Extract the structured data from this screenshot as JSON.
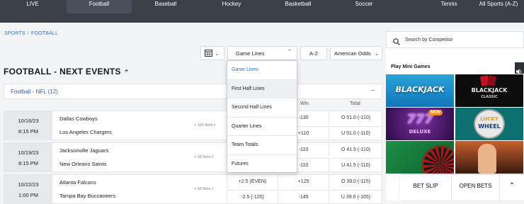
{
  "nav": {
    "items": [
      "LIVE",
      "Football",
      "Baseball",
      "Hockey",
      "Basketball",
      "Soccer",
      "Tennis",
      "All Sports (A-Z)"
    ],
    "active": "Football"
  },
  "breadcrumb": {
    "sports": "SPORTS",
    "sep": "/",
    "football": "FOOTBALL"
  },
  "controls": {
    "market": "Game Lines",
    "sort": "A-Z",
    "odds_format": "American Odds"
  },
  "section_title": "FOOTBALL - NEXT EVENTS",
  "league": {
    "label": "Football - NFL (12)",
    "collapse": "–"
  },
  "columns": {
    "win": "Win",
    "total": "Total"
  },
  "events": [
    {
      "date": "10/16/23",
      "time": "8:15 PM",
      "home": "Dallas Cowboys",
      "away": "Los Angeles Chargers",
      "bets": "+ 165 Bets",
      "spread_home": "",
      "spread_away": "",
      "win_home": "-130",
      "win_away": "+110",
      "total_home": "O 51.0 (-110)",
      "total_away": "U 51.0 (-110)"
    },
    {
      "date": "10/19/23",
      "time": "8:15 PM",
      "home": "Jacksonville Jaguars",
      "away": "New Orleans Saints",
      "bets": "+ 28 Bets",
      "spread_home": "",
      "spread_away": "",
      "win_home": "-110",
      "win_away": "-110",
      "total_home": "O 41.5 (-110)",
      "total_away": "U 41.5 (-110)"
    },
    {
      "date": "10/22/23",
      "time": "1:00 PM",
      "home": "Atlanta Falcons",
      "away": "Tampa Bay Buccaneers",
      "bets": "+ 58 Bets",
      "spread_home": "+2.5 (EVEN)",
      "spread_away": "-2.5 (-120)",
      "win_home": "+125",
      "win_away": "-145",
      "total_home": "O 39.0 (-115)",
      "total_away": "U 39.0 (-105)"
    }
  ],
  "market_dropdown": {
    "options": [
      "Game Lines",
      "First Half Lines",
      "Second Half Lines",
      "Quarter Lines",
      "Team Totals",
      "Futures"
    ],
    "selected": "Game Lines",
    "hovered": "First Half Lines"
  },
  "sidebar": {
    "search_placeholder": "Search by Competitor",
    "mini_games_title": "Play Mini Games",
    "games": [
      {
        "name": "BLACKJACK",
        "sub": ""
      },
      {
        "name": "BLACKJACK",
        "sub": "CLASSIC"
      },
      {
        "name": "777",
        "sub": "DELUXE",
        "badge": "NEW"
      },
      {
        "name": "LUCKY",
        "sub": "WHEEL"
      }
    ]
  },
  "bottom_bar": {
    "bet_slip": "BET SLIP",
    "open_bets": "OPEN BETS"
  },
  "colors": {
    "nav_bg": "#3a3f48",
    "link_blue": "#2f5fa6",
    "accent_blue": "#2f6fd6"
  }
}
